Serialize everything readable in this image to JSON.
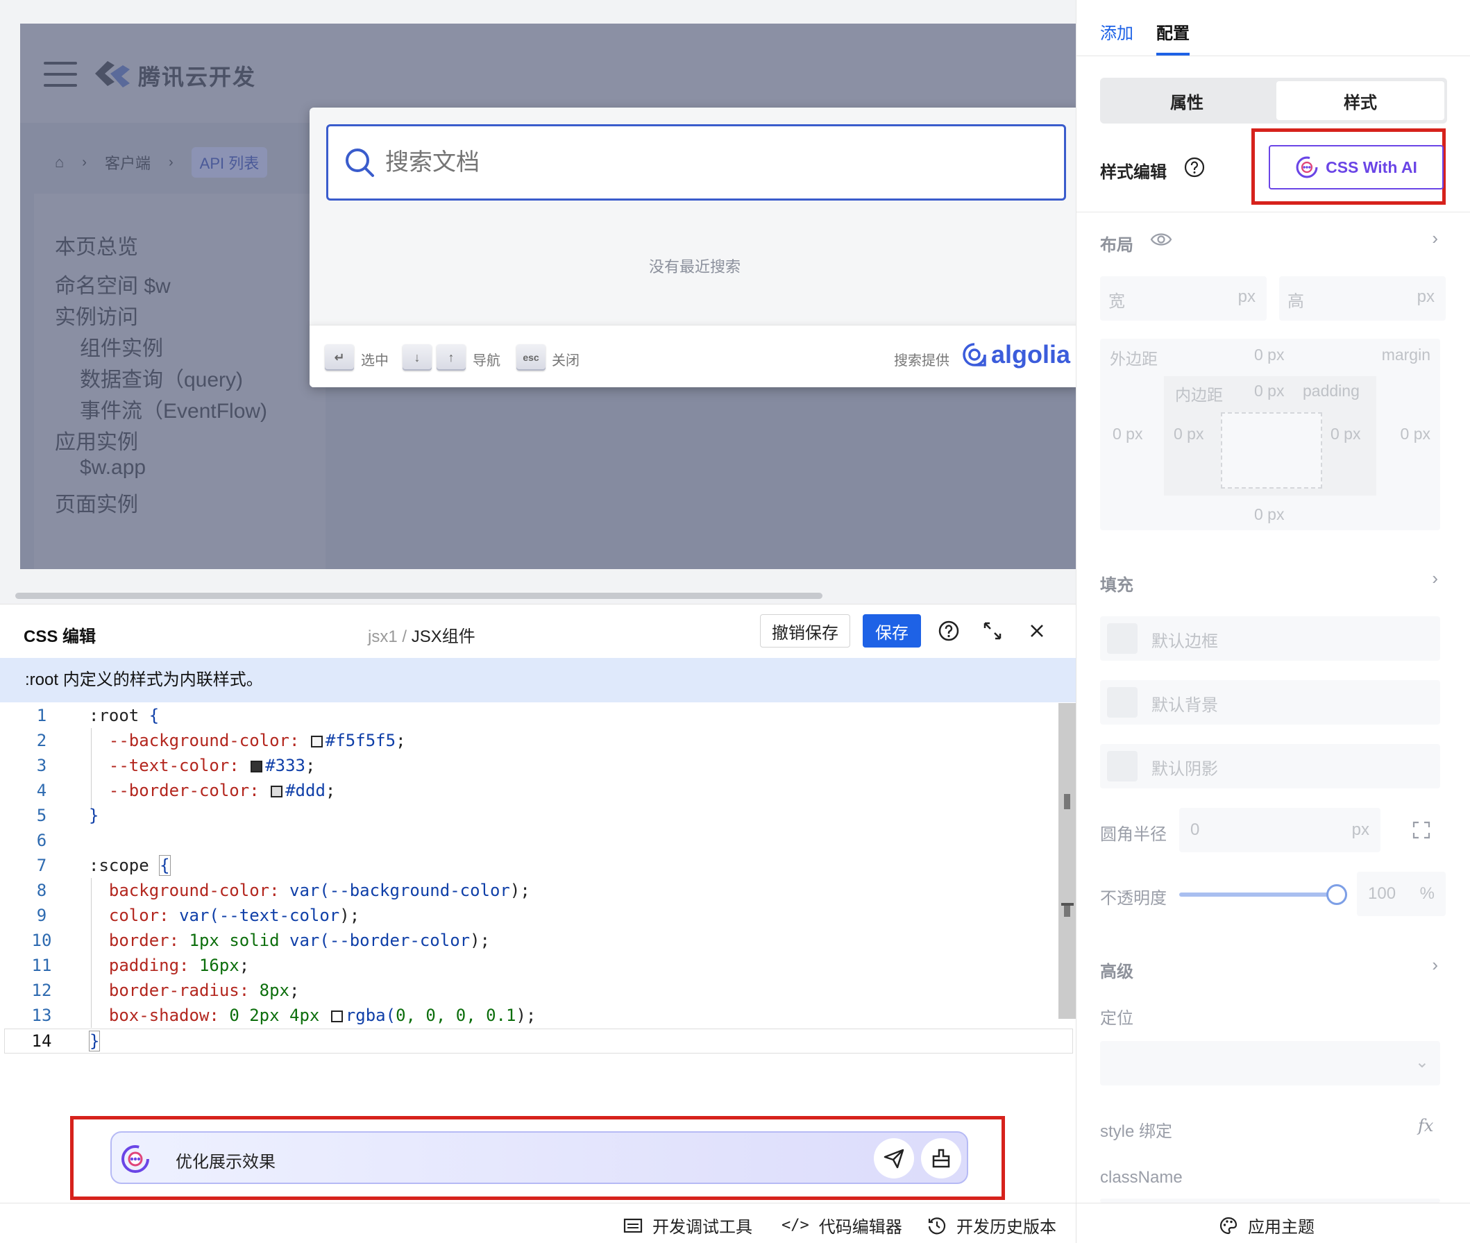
{
  "preview": {
    "site_name": "腾讯云开发",
    "breadcrumbs": [
      "客户端",
      "API 列表"
    ],
    "toc": [
      "本页总览",
      "命名空间 $w",
      "实例访问",
      "组件实例",
      "数据查询（query)",
      "事件流（EventFlow)",
      "应用实例",
      "$w.app",
      "页面实例"
    ]
  },
  "search": {
    "placeholder": "搜索文档",
    "empty": "没有最近搜索",
    "keys": [
      {
        "key": "↵",
        "label": "选中"
      },
      {
        "key": "↓",
        "label": ""
      },
      {
        "key": "↑",
        "label": "导航"
      },
      {
        "key": "esc",
        "label": "关闭"
      }
    ],
    "powered_by": "搜索提供",
    "algolia": "algolia"
  },
  "editor": {
    "title": "CSS 编辑",
    "crumb_parent": "jsx1",
    "crumb_sep": "/",
    "crumb_current": "JSX组件",
    "undo_label": "撤销保存",
    "save_label": "保存",
    "note": ":root 内定义的样式为内联样式。",
    "ai_prompt": "优化展示效果"
  },
  "code_lines": [
    {
      "n": "1"
    },
    {
      "n": "2"
    },
    {
      "n": "3"
    },
    {
      "n": "4"
    },
    {
      "n": "5"
    },
    {
      "n": "6"
    },
    {
      "n": "7"
    },
    {
      "n": "8"
    },
    {
      "n": "9"
    },
    {
      "n": "10"
    },
    {
      "n": "11"
    },
    {
      "n": "12"
    },
    {
      "n": "13"
    },
    {
      "n": "14"
    }
  ],
  "code_text": {
    "l1a": ":root",
    "l1b": "{",
    "l2p": "--background-color:",
    "l2v": "#f5f5f5",
    "l2s": ";",
    "l3p": "--text-color:",
    "l3v": "#333",
    "l3s": ";",
    "l4p": "--border-color:",
    "l4v": "#ddd",
    "l4s": ";",
    "l5": "}",
    "l7a": ":scope",
    "l7b": "{",
    "l8p": "background-color:",
    "l8k": "var(",
    "l8v": "--background-color",
    "l8e": ");",
    "l9p": "color:",
    "l9k": "var(",
    "l9v": "--text-color",
    "l9e": ");",
    "l10p": "border:",
    "l10v": "1px solid",
    "l10k": "var(",
    "l10v2": "--border-color",
    "l10e": ");",
    "l11p": "padding:",
    "l11v": "16px",
    "l11e": ";",
    "l12p": "border-radius:",
    "l12v": "8px",
    "l12e": ";",
    "l13p": "box-shadow:",
    "l13v": "0 2px 4px",
    "l13k": "rgba(",
    "l13v2": "0, 0, 0, 0.1",
    "l13e": ");",
    "l14": "}"
  },
  "swatches": {
    "bg": "#f5f5f5",
    "text": "#333333",
    "border": "#dddddd",
    "shadow": "#ffffff"
  },
  "status_bar": {
    "devtools": "开发调试工具",
    "code_editor": "代码编辑器",
    "history": "开发历史版本",
    "theme": "应用主题"
  },
  "panel": {
    "tabs": [
      "添加",
      "配置"
    ],
    "seg": [
      "属性",
      "样式"
    ],
    "style_edit": "样式编辑",
    "css_ai": "CSS With AI",
    "layout": "布局",
    "width_label": "宽",
    "height_label": "高",
    "unit_px": "px",
    "margin_cn": "外边距",
    "margin_en": "margin",
    "padding_cn": "内边距",
    "padding_en": "padding",
    "zero_px": "0 px",
    "fill": "填充",
    "default_border": "默认边框",
    "default_bg": "默认背景",
    "default_shadow": "默认阴影",
    "radius_label": "圆角半径",
    "radius_value": "0",
    "opacity_label": "不透明度",
    "opacity_value": "100",
    "percent": "%",
    "advanced": "高级",
    "position": "定位",
    "style_binding": "style 绑定",
    "fx": "fx",
    "classname": "className"
  },
  "colors": {
    "accent": "#1e62e6",
    "ai_purple": "#6a45e6",
    "highlight_red": "#d6221c"
  }
}
